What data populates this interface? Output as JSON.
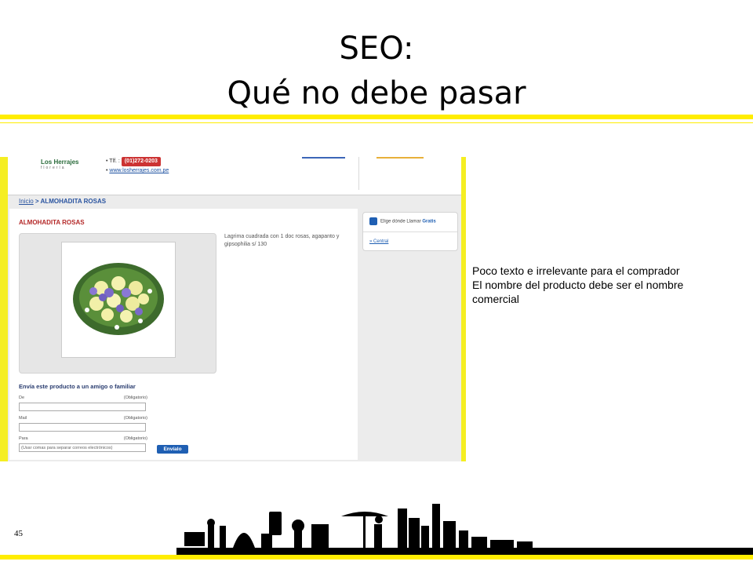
{
  "slide": {
    "title_line1": "SEO:",
    "title_line2": "Qué no debe pasar",
    "page_number": "45",
    "note_lines": [
      "Poco texto e irrelevante para el comprador",
      "El nombre del producto debe ser el nombre comercial"
    ],
    "colors": {
      "accent": "#ffed00",
      "link": "#1f5fb3",
      "product_title": "#b42828"
    }
  },
  "shot": {
    "logo": "Los Herrajes",
    "logo_sub": "florería",
    "tel_label": "• Tlf. :",
    "phone": "(01)272-0203",
    "site_url": "www.losherrajes.com.pe",
    "breadcrumb_home": "Inicio",
    "breadcrumb_sep": ">",
    "breadcrumb_current": "ALMOHADITA ROSAS",
    "product_title": "ALMOHADITA ROSAS",
    "description": "Lagrima cuadrada con 1 doc rosas, agapanto y gipsophilia s/ 130",
    "share_title": "Envía este producto a un amigo o familiar",
    "fields": {
      "de_label": "De",
      "mail_label": "Mail",
      "para_label": "Para",
      "required": "(Obligatorio)",
      "para_placeholder": "(Usar comas para separar correos electrónicos)"
    },
    "send_button": "Envíalo",
    "side_call_prefix": "Elige dónde Llamar",
    "side_call_free": "Gratis",
    "side_link": "» Central"
  }
}
